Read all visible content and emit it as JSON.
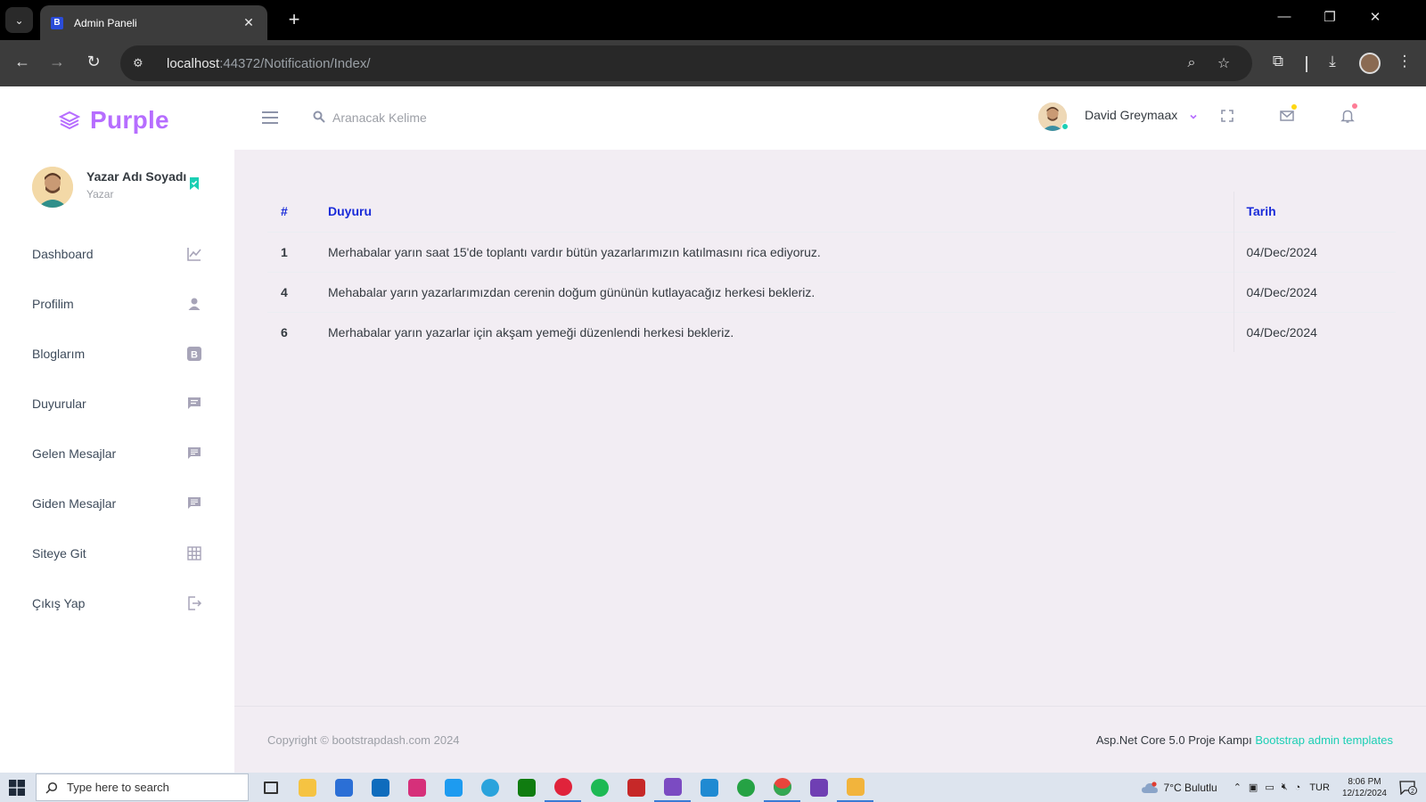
{
  "browser": {
    "tab_title": "Admin Paneli",
    "tab_close": "✕",
    "new_tab": "+",
    "url_host": "localhost",
    "url_path": ":44372/Notification/Index/"
  },
  "sidebar": {
    "brand": "Purple",
    "profile": {
      "name": "Yazar Adı Soyadı",
      "role": "Yazar"
    },
    "items": [
      {
        "label": "Dashboard",
        "icon": "chart-line-icon"
      },
      {
        "label": "Profilim",
        "icon": "user-icon"
      },
      {
        "label": "Bloglarım",
        "icon": "blog-icon"
      },
      {
        "label": "Duyurular",
        "icon": "message-text-icon"
      },
      {
        "label": "Gelen Mesajlar",
        "icon": "inbox-message-icon"
      },
      {
        "label": "Giden Mesajlar",
        "icon": "outbox-message-icon"
      },
      {
        "label": "Siteye Git",
        "icon": "grid-icon"
      },
      {
        "label": "Çıkış Yap",
        "icon": "logout-icon"
      }
    ]
  },
  "navbar": {
    "search_placeholder": "Aranacak Kelime",
    "user_name": "David Greymaax",
    "mail_dot_color": "#fed713",
    "bell_dot_color": "#fe7c96"
  },
  "table": {
    "headers": [
      "#",
      "Duyuru",
      "Tarih"
    ],
    "rows": [
      {
        "id": "1",
        "text": "Merhabalar yarın saat 15'de toplantı vardır bütün yazarlarımızın katılmasını rica ediyoruz.",
        "date": "04/Dec/2024"
      },
      {
        "id": "4",
        "text": "Mehabalar yarın yazarlarımızdan cerenin doğum gününün kutlayacağız herkesi bekleriz.",
        "date": "04/Dec/2024"
      },
      {
        "id": "6",
        "text": "Merhabalar yarın yazarlar için akşam yemeği düzenlendi herkesi bekleriz.",
        "date": "04/Dec/2024"
      }
    ]
  },
  "footer": {
    "copyright": "Copyright © bootstrapdash.com 2024",
    "right_text": "Asp.Net Core 5.0 Proje Kampı",
    "right_link": "Bootstrap admin templates"
  },
  "taskbar": {
    "search_placeholder": "Type here to search",
    "weather": "7°C  Bulutlu",
    "lang": "TUR",
    "time": "8:06 PM",
    "date": "12/12/2024",
    "notif_count": "2"
  },
  "colors": {
    "brand": "#b66dff",
    "accent": "#1bcfb4",
    "table_header": "#1a2bd9",
    "content_bg": "#f2edf3"
  }
}
